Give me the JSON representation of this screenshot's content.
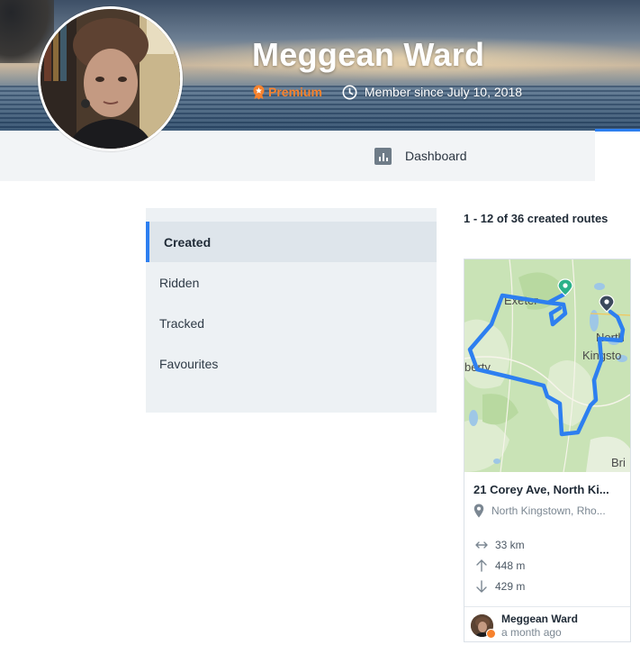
{
  "profile": {
    "name": "Meggean Ward",
    "badge": "Premium",
    "member_since": "Member since July 10, 2018"
  },
  "nav": {
    "dashboard_label": "Dashboard"
  },
  "sidebar": {
    "items": [
      {
        "label": "Created",
        "active": true
      },
      {
        "label": "Ridden",
        "active": false
      },
      {
        "label": "Tracked",
        "active": false
      },
      {
        "label": "Favourites",
        "active": false
      }
    ]
  },
  "routes": {
    "count_text": "1 - 12 of 36 created routes",
    "cards": [
      {
        "title": "21 Corey Ave, North Ki...",
        "location": "North Kingstown, Rho...",
        "distance": "33 km",
        "elevation_gain": "448 m",
        "elevation_loss": "429 m",
        "author": "Meggean Ward",
        "time": "a month ago",
        "map_labels": {
          "exeter": "Exeter",
          "liberty": "berty",
          "north_kingstown_1": "North",
          "north_kingstown_2": "Kingsto",
          "bottom": "Bri"
        }
      }
    ]
  },
  "colors": {
    "accent": "#2d7ff0",
    "premium": "#f7822d",
    "route_line": "#2d7ff0",
    "map_green": "#c9e3b6",
    "start_pin": "#2bb28a",
    "end_pin": "#3c4a5c"
  }
}
